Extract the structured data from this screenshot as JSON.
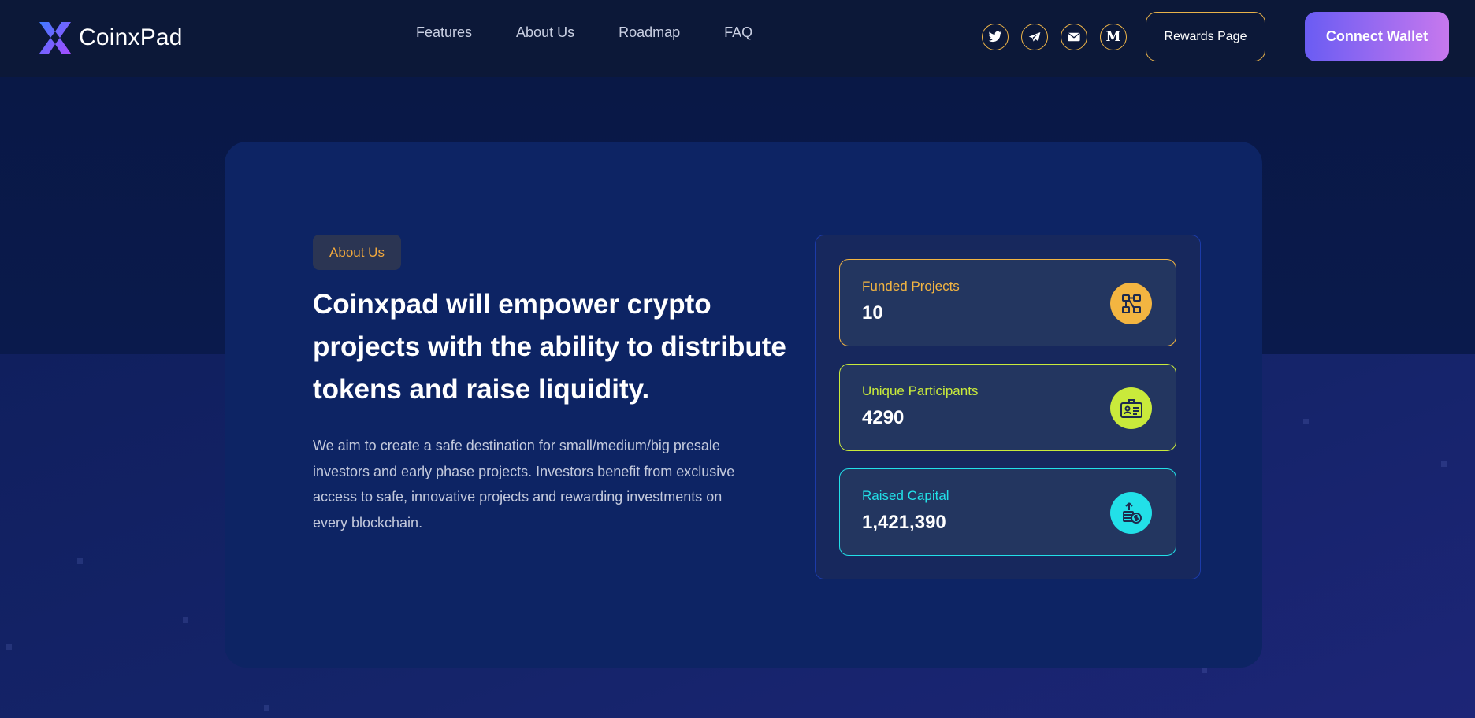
{
  "brand": {
    "name": "CoinxPad"
  },
  "nav": {
    "items": [
      "Features",
      "About Us",
      "Roadmap",
      "FAQ"
    ]
  },
  "socials": [
    {
      "icon": "twitter-icon"
    },
    {
      "icon": "telegram-icon"
    },
    {
      "icon": "mail-icon"
    },
    {
      "icon": "medium-icon",
      "glyph": "M"
    }
  ],
  "header": {
    "rewards_label": "Rewards Page",
    "connect_label": "Connect Wallet"
  },
  "about": {
    "tag": "About Us",
    "headline": "Coinxpad will empower crypto projects with the ability to distribute tokens and raise liquidity.",
    "description": "We aim to create a safe destination for small/medium/big presale investors and early phase projects. Investors benefit from exclusive access to safe, innovative projects and rewarding investments on every blockchain."
  },
  "stats": [
    {
      "label": "Funded Projects",
      "value": "10",
      "color": "#f3b541",
      "icon": "projects-icon"
    },
    {
      "label": "Unique Participants",
      "value": "4290",
      "color": "#c9ea3b",
      "icon": "id-card-icon"
    },
    {
      "label": "Raised Capital",
      "value": "1,421,390",
      "color": "#22e0e8",
      "icon": "money-icon"
    }
  ],
  "colors": {
    "accent_orange": "#f3a93c",
    "accent_gradient_start": "#6a5cf3",
    "accent_gradient_end": "#c778ee",
    "card_background": "#0d2464"
  }
}
